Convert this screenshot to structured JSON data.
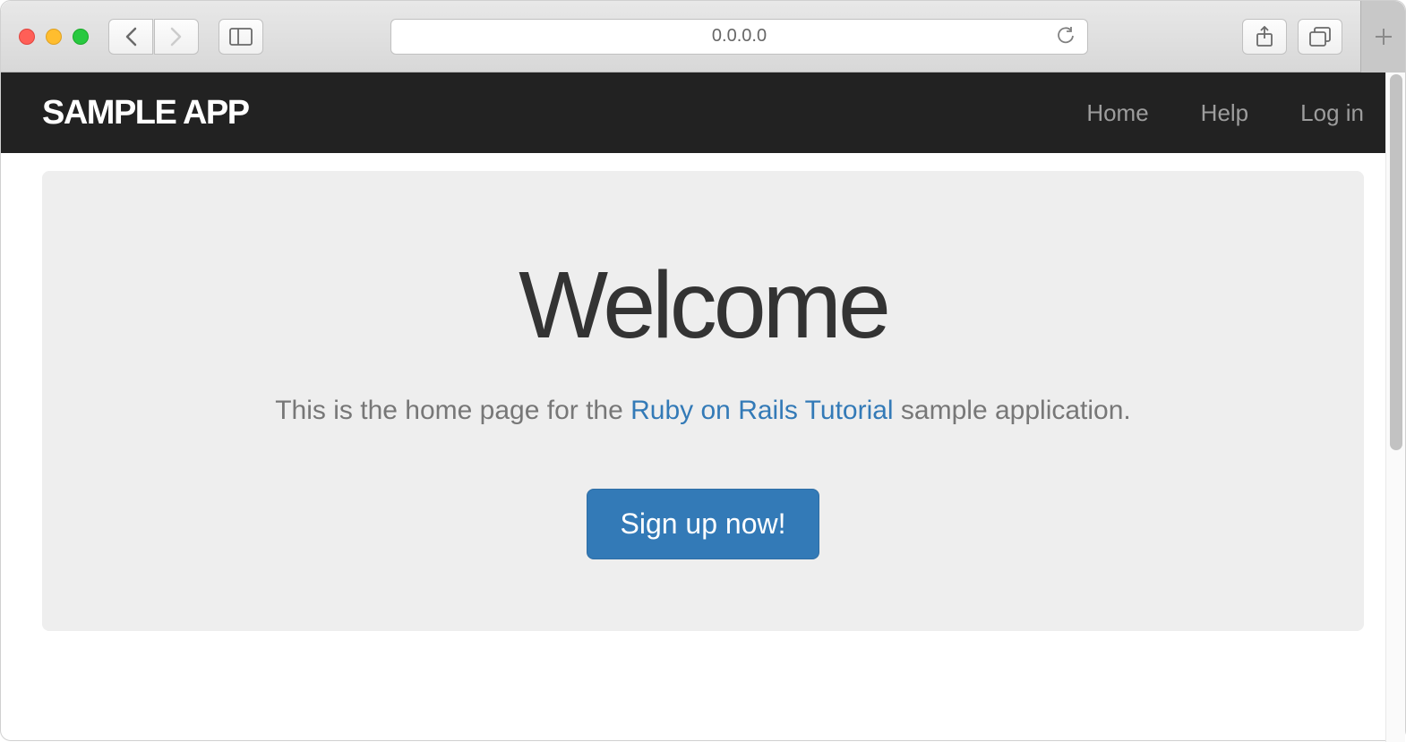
{
  "browser": {
    "url": "0.0.0.0"
  },
  "navbar": {
    "brand": "SAMPLE APP",
    "links": {
      "home": "Home",
      "help": "Help",
      "login": "Log in"
    }
  },
  "hero": {
    "title": "Welcome",
    "subtitle_prefix": "This is the home page for the ",
    "subtitle_link": "Ruby on Rails Tutorial",
    "subtitle_suffix": " sample application.",
    "signup_button": "Sign up now!"
  }
}
